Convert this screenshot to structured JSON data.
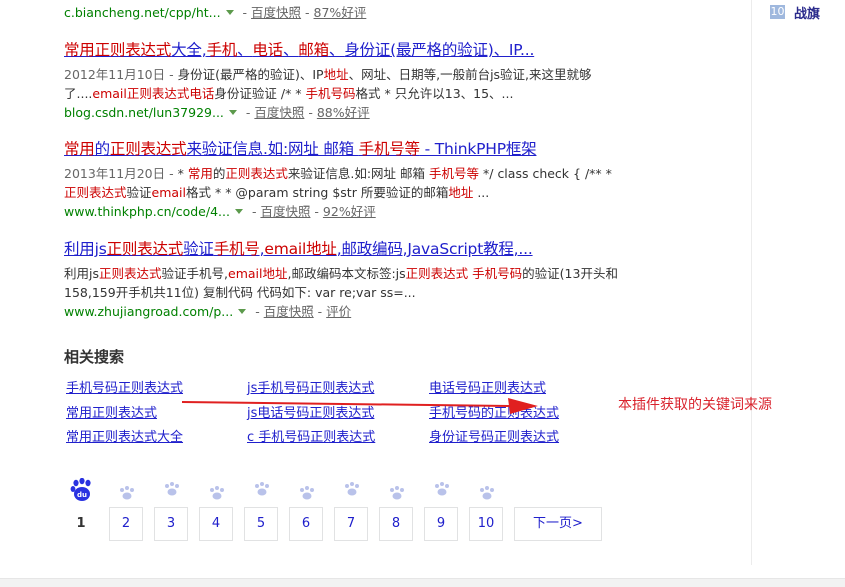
{
  "results": [
    {
      "url": "c.biancheng.net/cpp/ht...",
      "snapshot": "百度快照",
      "rating": "87%好评"
    },
    {
      "title_parts": [
        {
          "t": "常用正则表达式",
          "em": true
        },
        {
          "t": "大全,",
          "em": false
        },
        {
          "t": "手机",
          "em": true
        },
        {
          "t": "、",
          "em": false
        },
        {
          "t": "电话",
          "em": true
        },
        {
          "t": "、",
          "em": false
        },
        {
          "t": "邮箱",
          "em": true
        },
        {
          "t": "、",
          "em": false
        },
        {
          "t": "身份证(最严格的验证)、IP...",
          "em": false
        }
      ],
      "snippet_parts": [
        {
          "t": "2012年11月10日 - ",
          "date": true
        },
        {
          "t": "身份证(最严格的验证)、IP"
        },
        {
          "t": "地址",
          "em": true
        },
        {
          "t": "、网址、日期等,一般前台js验证,来这里就够了....",
          "em": false
        },
        {
          "t": "email正则表达式电话",
          "em": true
        },
        {
          "t": "身份证验证 /* * "
        },
        {
          "t": "手机号码",
          "em": true
        },
        {
          "t": "格式 * 只允许以13、15、..."
        }
      ],
      "url": "blog.csdn.net/lun37929...",
      "snapshot": "百度快照",
      "rating": "88%好评"
    },
    {
      "title_parts": [
        {
          "t": "常用",
          "em": true
        },
        {
          "t": "的",
          "em": false
        },
        {
          "t": "正则表达式",
          "em": true
        },
        {
          "t": "来验证信息.如:网址 邮箱 ",
          "em": false
        },
        {
          "t": "手机号等",
          "em": true
        },
        {
          "t": " - ThinkPHP框架",
          "em": false
        }
      ],
      "snippet_parts": [
        {
          "t": "2013年11月20日 - ",
          "date": true
        },
        {
          "t": "* "
        },
        {
          "t": "常用",
          "em": true
        },
        {
          "t": "的"
        },
        {
          "t": "正则表达式",
          "em": true
        },
        {
          "t": "来验证信息.如:网址 邮箱 "
        },
        {
          "t": "手机号等",
          "em": true
        },
        {
          "t": " */ class check { /** * "
        },
        {
          "t": "正则表达式",
          "em": true
        },
        {
          "t": "验证"
        },
        {
          "t": "email",
          "em": true
        },
        {
          "t": "格式 * * @param string $str 所要验证的邮箱"
        },
        {
          "t": "地址",
          "em": true
        },
        {
          "t": " ..."
        }
      ],
      "url": "www.thinkphp.cn/code/4...",
      "snapshot": "百度快照",
      "rating": "92%好评"
    },
    {
      "title_parts": [
        {
          "t": "利用js",
          "em": false
        },
        {
          "t": "正则表达式",
          "em": true
        },
        {
          "t": "验证",
          "em": false
        },
        {
          "t": "手机号",
          "em": true
        },
        {
          "t": ",",
          "em": false
        },
        {
          "t": "email地址",
          "em": true
        },
        {
          "t": ",邮政编码,JavaScript教程,...",
          "em": false
        }
      ],
      "snippet_parts": [
        {
          "t": "利用js"
        },
        {
          "t": "正则表达式",
          "em": true
        },
        {
          "t": "验证手机号,"
        },
        {
          "t": "email地址",
          "em": true
        },
        {
          "t": ",邮政编码本文标签:js"
        },
        {
          "t": "正则表达式",
          "em": true
        },
        {
          "t": " "
        },
        {
          "t": "手机号码",
          "em": true
        },
        {
          "t": "的验证(13开头和158,159开手机共11位) 复制代码 代码如下: var re;var ss=..."
        }
      ],
      "url": "www.zhujiangroad.com/p...",
      "snapshot": "百度快照",
      "rating": "评价"
    }
  ],
  "related": {
    "title": "相关搜索",
    "items": [
      "手机号码正则表达式",
      "js手机号码正则表达式",
      "电话号码正则表达式",
      "常用正则表达式",
      "js电话号码正则表达式",
      "手机号码的正则表达式",
      "常用正则表达式大全",
      "c 手机号码正则表达式",
      "身份证号码正则表达式"
    ]
  },
  "annotation": "本插件获取的关键词来源",
  "pagination": {
    "current": "1",
    "pages": [
      "2",
      "3",
      "4",
      "5",
      "6",
      "7",
      "8",
      "9",
      "10"
    ],
    "next": "下一页>"
  },
  "sidebar": {
    "badge": "10",
    "label": "战旗"
  },
  "colors": {
    "link": "#2020cc",
    "highlight": "#cc0000",
    "url": "#008000",
    "annotation": "#d9232d"
  }
}
